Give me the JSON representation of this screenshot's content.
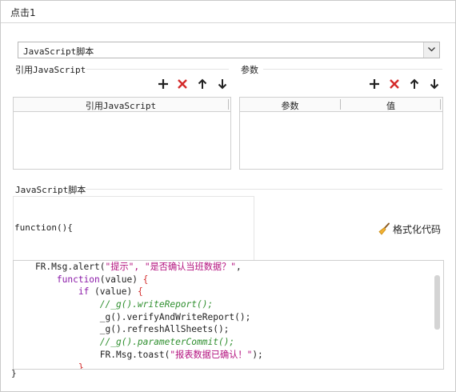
{
  "window": {
    "title": "点击1"
  },
  "script_type": {
    "selected": "JavaScript脚本"
  },
  "ref_js": {
    "section_label": "引用JavaScript",
    "column_header": "引用JavaScript"
  },
  "params": {
    "section_label": "参数",
    "columns": [
      "参数",
      "值"
    ]
  },
  "js_script": {
    "section_label": "JavaScript脚本",
    "function_header": "function(){",
    "format_label": "格式化代码",
    "closing": "}",
    "code_lines": [
      [
        {
          "t": "    FR.Msg.alert(",
          "c": "pl"
        },
        {
          "t": "\"提示\", \"是否确认当班数据？\"",
          "c": "str"
        },
        {
          "t": ",",
          "c": "pl"
        }
      ],
      [
        {
          "t": "        ",
          "c": "pl"
        },
        {
          "t": "function",
          "c": "kw"
        },
        {
          "t": "(value) ",
          "c": "pl"
        },
        {
          "t": "{",
          "c": "pn"
        }
      ],
      [
        {
          "t": "            ",
          "c": "pl"
        },
        {
          "t": "if",
          "c": "kw"
        },
        {
          "t": " (value) ",
          "c": "pl"
        },
        {
          "t": "{",
          "c": "pn"
        }
      ],
      [
        {
          "t": "                ",
          "c": "pl"
        },
        {
          "t": "//_g().writeReport();",
          "c": "cm"
        }
      ],
      [
        {
          "t": "                _g().verifyAndWriteReport();",
          "c": "pl"
        }
      ],
      [
        {
          "t": "                _g().refreshAllSheets();",
          "c": "pl"
        }
      ],
      [
        {
          "t": "                ",
          "c": "pl"
        },
        {
          "t": "//_g().parameterCommit();",
          "c": "cm"
        }
      ],
      [
        {
          "t": "                FR.Msg.toast(",
          "c": "pl"
        },
        {
          "t": "\"报表数据已确认！\"",
          "c": "str"
        },
        {
          "t": ");",
          "c": "pl"
        }
      ],
      [
        {
          "t": "            ",
          "c": "pl"
        },
        {
          "t": "}",
          "c": "pn"
        }
      ]
    ]
  },
  "icons": [
    "plus-icon",
    "delete-x-icon",
    "arrow-up-icon",
    "arrow-down-icon",
    "chevron-down-icon",
    "broom-icon"
  ],
  "colors": {
    "delete_red": "#d42a2a",
    "keyword": "#8a19a8",
    "string": "#b3117e",
    "comment": "#2f8f2f"
  }
}
